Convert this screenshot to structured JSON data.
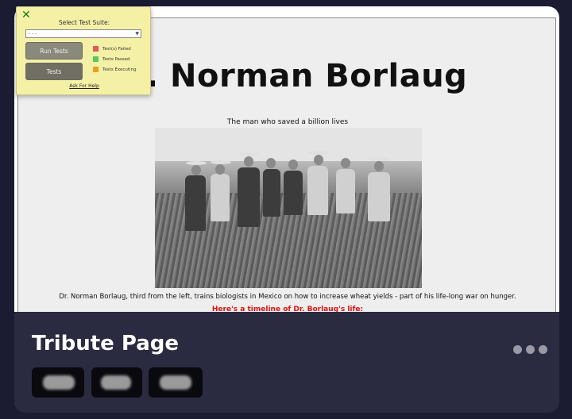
{
  "test_panel": {
    "title": "Select Test Suite:",
    "select_value": "- - -",
    "run_tests_label": "Run Tests",
    "tests_label": "Tests",
    "legend": [
      {
        "label": "Test(s) Failed",
        "color": "#e05a5a"
      },
      {
        "label": "Tests Passed",
        "color": "#5ac85a"
      },
      {
        "label": "Tests Executing",
        "color": "#e8a020"
      }
    ],
    "help_link": "Ask For Help"
  },
  "preview": {
    "heading": "Dr. Norman Borlaug",
    "subtitle": "The man who saved a billion lives",
    "caption": "Dr. Norman Borlaug, third from the left, trains biologists in Mexico on how to increase wheat yields - part of his life-long war on hunger.",
    "timeline_heading": "Here's a timeline of Dr. Borlaug's life:"
  },
  "card": {
    "title": "Tribute Page",
    "more_icon": "more-horizontal-icon",
    "tag_count": 3
  }
}
